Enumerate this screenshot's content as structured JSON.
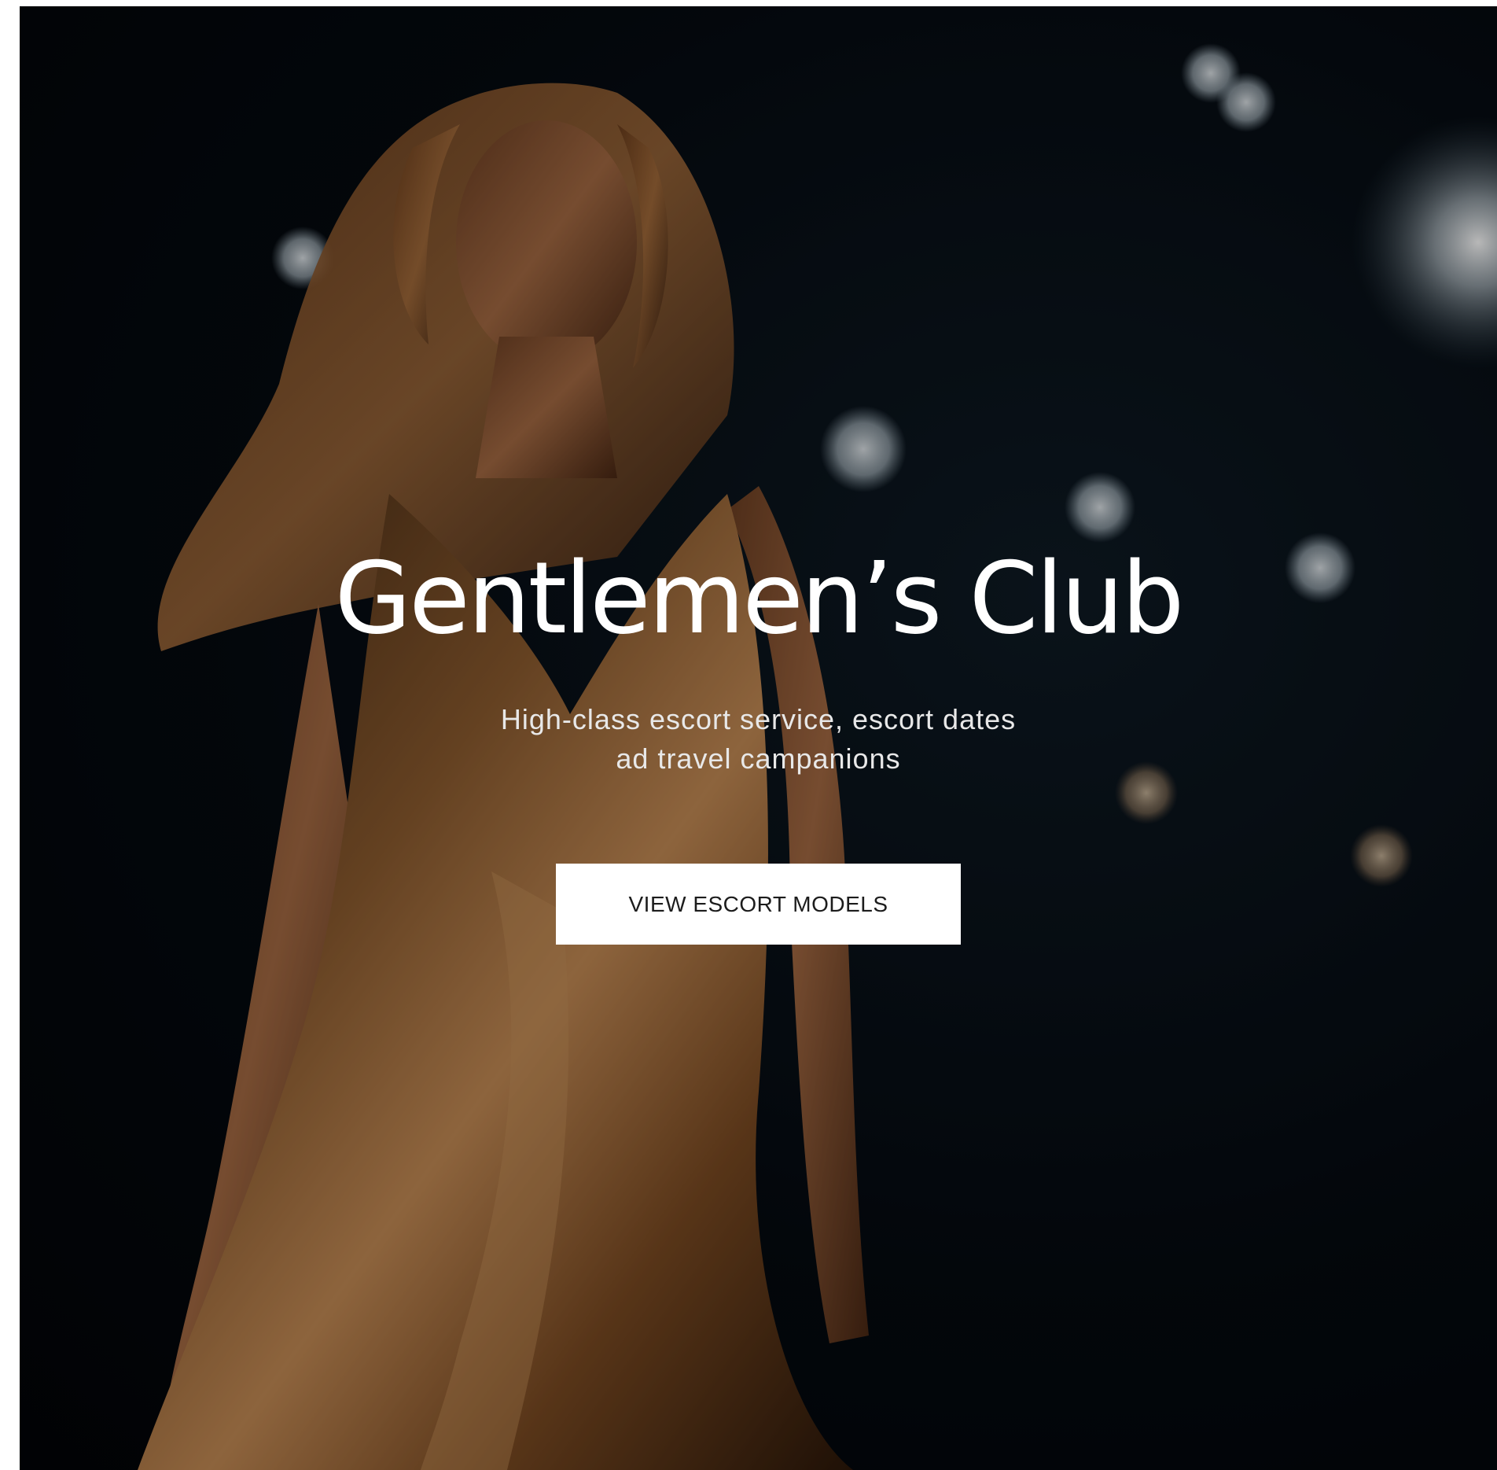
{
  "hero": {
    "title": "Gentlemen’s Club",
    "subtitle_line1": "High-class escort service, escort dates",
    "subtitle_line2": "ad travel campanions",
    "cta_label": "VIEW ESCORT MODELS"
  },
  "colors": {
    "background": "#050a10",
    "title_text": "#ffffff",
    "button_background": "#ffffff",
    "button_text": "#1c1c1c",
    "dress_gold": "#8a5a2e"
  }
}
